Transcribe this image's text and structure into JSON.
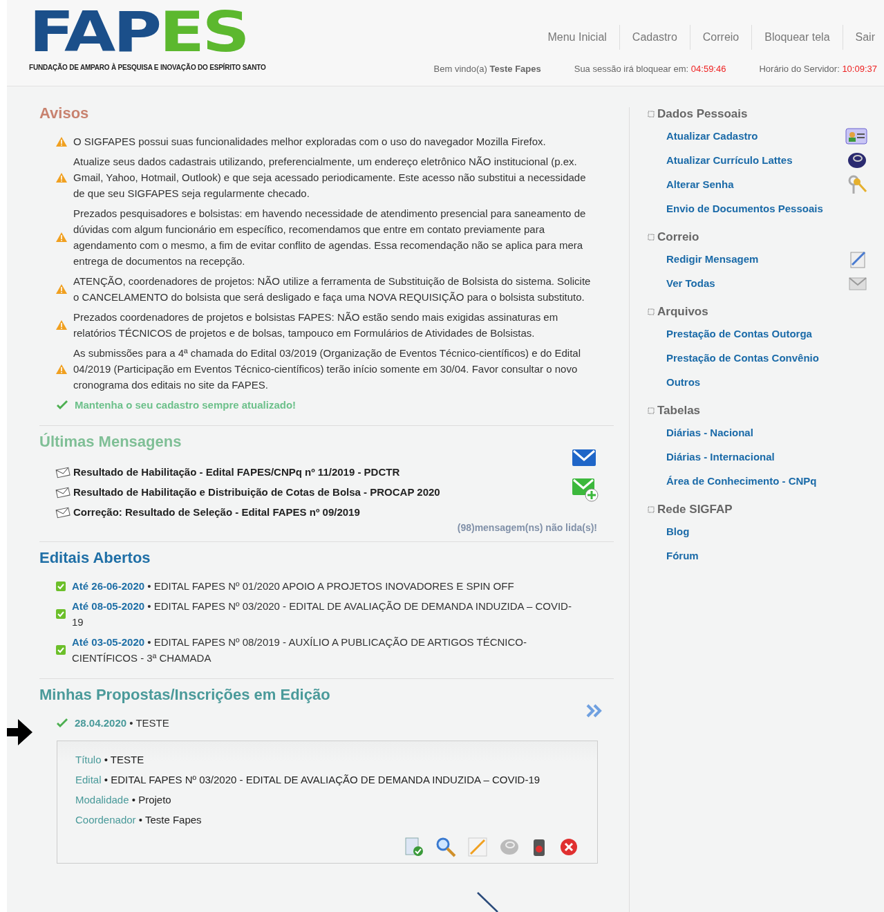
{
  "header": {
    "logo": {
      "part_1": "FAP",
      "part_2": "ES",
      "subtitle": "FUNDAÇÃO DE AMPARO À PESQUISA E INOVAÇÃO DO ESPÍRITO SANTO"
    },
    "nav": [
      "Menu Inicial",
      "Cadastro",
      "Correio",
      "Bloquear tela",
      "Sair"
    ],
    "welcome_label": "Bem vindo(a)",
    "user": "Teste Fapes",
    "session_label": "Sua sessão irá bloquear em:",
    "session_time": "04:59:46",
    "server_label": "Horário do Servidor:",
    "server_time": "10:09:37"
  },
  "avisos": {
    "title": "Avisos",
    "items": [
      {
        "kind": "warning",
        "text": "O SIGFAPES possui suas funcionalidades melhor exploradas com o uso do navegador Mozilla Firefox."
      },
      {
        "kind": "warning",
        "text": "Atualize seus dados cadastrais utilizando, preferencialmente, um endereço eletrônico NÃO institucional (p.ex. Gmail, Yahoo, Hotmail, Outlook) e que seja acessado periodicamente. Este acesso não substitui a necessidade de que seu SIGFAPES seja regularmente checado."
      },
      {
        "kind": "warning",
        "text": "Prezados pesquisadores e bolsistas: em havendo necessidade de atendimento presencial para saneamento de dúvidas com algum funcionário em específico, recomendamos que entre em contato previamente para agendamento com o mesmo, a fim de evitar conflito de agendas. Essa recomendação não se aplica para mera entrega de documentos na recepção."
      },
      {
        "kind": "warning",
        "text": "ATENÇÃO, coordenadores de projetos: NÃO utilize a ferramenta de Substituição de Bolsista do sistema. Solicite o CANCELAMENTO do bolsista que será desligado e faça uma NOVA REQUISIÇÃO para o bolsista substituto."
      },
      {
        "kind": "warning",
        "text": "Prezados coordenadores de projetos e bolsistas FAPES: NÃO estão sendo mais exigidas assinaturas em relatórios TÉCNICOS de projetos e de bolsas, tampouco em Formulários de Atividades de Bolsistas."
      },
      {
        "kind": "warning",
        "text": "As submissões para a 4ª chamada do Edital 03/2019 (Organização de Eventos Técnico-científicos) e do Edital 04/2019 (Participação em Eventos Técnico-científicos) terão início somente em 30/04. Favor consultar o novo cronograma dos editais no site da FAPES."
      },
      {
        "kind": "success",
        "text": "Mantenha o seu cadastro sempre atualizado!"
      }
    ]
  },
  "mensagens": {
    "title": "Últimas Mensagens",
    "items": [
      "Resultado de Habilitação - Edital FAPES/CNPq nº 11/2019 - PDCTR",
      "Resultado de Habilitação e Distribuição de Cotas de Bolsa - PROCAP 2020",
      "Correção: Resultado de Seleção - Edital FAPES nº 09/2019"
    ],
    "unread": "(98)mensagem(ns) não lida(s)!"
  },
  "editais": {
    "title": "Editais Abertos",
    "separator": "•",
    "items": [
      {
        "date": "Até 26-06-2020",
        "text": "EDITAL FAPES Nº 01/2020 APOIO A PROJETOS INOVADORES E SPIN OFF"
      },
      {
        "date": "Até 08-05-2020",
        "text": "EDITAL FAPES Nº 03/2020 - EDITAL DE AVALIAÇÃO DE DEMANDA INDUZIDA – COVID-19"
      },
      {
        "date": "Até 03-05-2020",
        "text": "EDITAL FAPES Nº 08/2019 - AUXÍLIO A PUBLICAÇÃO DE ARTIGOS TÉCNICO-CIENTÍFICOS - 3ª CHAMADA"
      }
    ]
  },
  "propostas": {
    "title": "Minhas Propostas/Inscrições em Edição",
    "separator": "•",
    "items": [
      {
        "date": "28.04.2020",
        "name": "TESTE",
        "fields": [
          {
            "label": "Título",
            "value": "TESTE"
          },
          {
            "label": "Edital",
            "value": "EDITAL FAPES Nº 03/2020 - EDITAL DE AVALIAÇÃO DE DEMANDA INDUZIDA – COVID-19"
          },
          {
            "label": "Modalidade",
            "value": "Projeto"
          },
          {
            "label": "Coordenador",
            "value": "Teste Fapes"
          }
        ]
      }
    ]
  },
  "sidebar": [
    {
      "title": "Dados Pessoais",
      "items": [
        "Atualizar Cadastro",
        "Atualizar Currículo Lattes",
        "Alterar Senha",
        "Envio de Documentos Pessoais"
      ]
    },
    {
      "title": "Correio",
      "items": [
        "Redigir Mensagem",
        "Ver Todas"
      ]
    },
    {
      "title": "Arquivos",
      "items": [
        "Prestação de Contas Outorga",
        "Prestação de Contas Convênio",
        "Outros"
      ]
    },
    {
      "title": "Tabelas",
      "items": [
        "Diárias - Nacional",
        "Diárias - Internacional",
        "Área de Conhecimento - CNPq"
      ]
    },
    {
      "title": "Rede SIGFAP",
      "items": [
        "Blog",
        "Fórum"
      ]
    }
  ]
}
